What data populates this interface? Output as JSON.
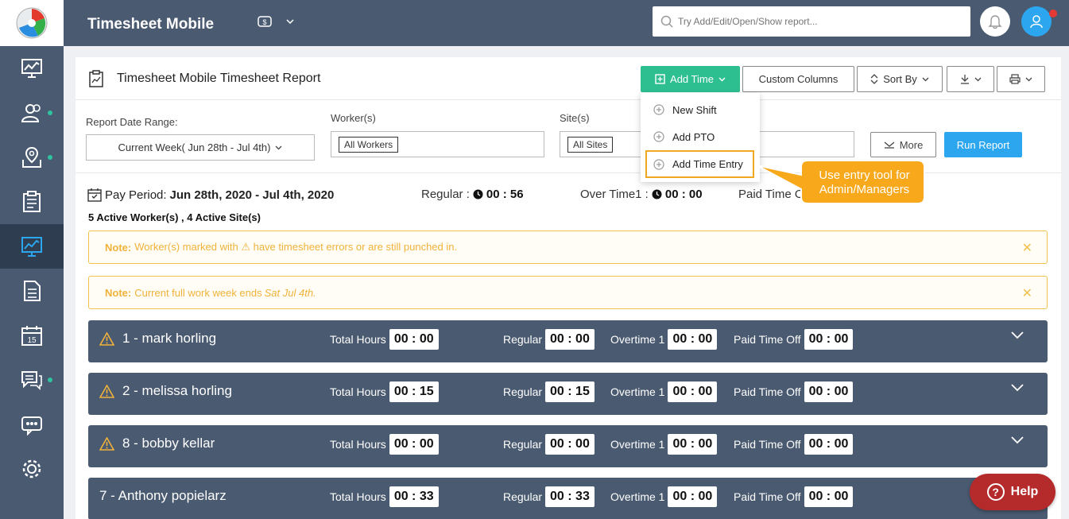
{
  "app": {
    "title": "Timesheet Mobile"
  },
  "header": {
    "search_placeholder": "Try Add/Edit/Open/Show report...",
    "currency_icon": "currency-icon"
  },
  "sidebar": {
    "items": [
      {
        "icon": "dashboard-chart-icon"
      },
      {
        "icon": "users-icon",
        "dot": true
      },
      {
        "icon": "map-pin-icon",
        "dot": true
      },
      {
        "icon": "clipboard-icon"
      },
      {
        "icon": "reports-icon",
        "active": true
      },
      {
        "icon": "document-icon"
      },
      {
        "icon": "calendar-icon",
        "date": "15"
      },
      {
        "icon": "chat-icon",
        "dot": true
      },
      {
        "icon": "more-icon"
      },
      {
        "icon": "settings-icon"
      }
    ]
  },
  "report": {
    "title": "Timesheet Mobile Timesheet Report",
    "add_time_label": "Add Time",
    "custom_columns_label": "Custom Columns",
    "sort_by_label": "Sort By"
  },
  "dropdown": {
    "items": [
      "New Shift",
      "Add PTO",
      "Add Time Entry"
    ]
  },
  "callout": {
    "text": "Use entry tool for Admin/Managers"
  },
  "filters": {
    "date_range_label": "Report Date Range:",
    "date_range_value": "Current Week( Jun 28th - Jul 4th)",
    "workers_label": "Worker(s)",
    "workers_value": "All Workers",
    "sites_label": "Site(s)",
    "sites_value": "All Sites",
    "more_label": "More",
    "run_label": "Run Report"
  },
  "pay_period": {
    "label": "Pay Period:",
    "value": "Jun 28th, 2020 - Jul 4th, 2020",
    "regular_label": "Regular :",
    "regular_value": "00 : 56",
    "overtime_label": "Over Time1 :",
    "overtime_value": "00 : 00",
    "pto_label": "Paid Time Of",
    "summary": "5 Active Worker(s) , 4 Active Site(s)"
  },
  "notes": [
    {
      "label": "Note:",
      "text": "Worker(s) marked with ⚠ have timesheet errors or are still punched in.",
      "emph": ""
    },
    {
      "label": "Note:",
      "text": "Current full work week ends ",
      "emph": "Sat Jul 4th."
    }
  ],
  "columns": {
    "total": "Total Hours",
    "regular": "Regular",
    "overtime": "Overtime 1",
    "pto": "Paid Time Off"
  },
  "workers": [
    {
      "name": "1 - mark horling",
      "warning": true,
      "total": "00 : 00",
      "regular": "00 : 00",
      "overtime": "00 : 00",
      "pto": "00 : 00"
    },
    {
      "name": "2 - melissa horling",
      "warning": true,
      "total": "00 : 15",
      "regular": "00 : 15",
      "overtime": "00 : 00",
      "pto": "00 : 00"
    },
    {
      "name": "8 - bobby kellar",
      "warning": true,
      "total": "00 : 00",
      "regular": "00 : 00",
      "overtime": "00 : 00",
      "pto": "00 : 00"
    },
    {
      "name": "7 - Anthony popielarz",
      "warning": false,
      "total": "00 : 33",
      "regular": "00 : 33",
      "overtime": "00 : 00",
      "pto": "00 : 00"
    }
  ],
  "help": {
    "label": "Help"
  },
  "colors": {
    "sidebar": "#4a5a70",
    "accent_green": "#2ebf91",
    "accent_blue": "#2da6f0",
    "warning": "#f0b23a",
    "help": "#b52a2a"
  }
}
